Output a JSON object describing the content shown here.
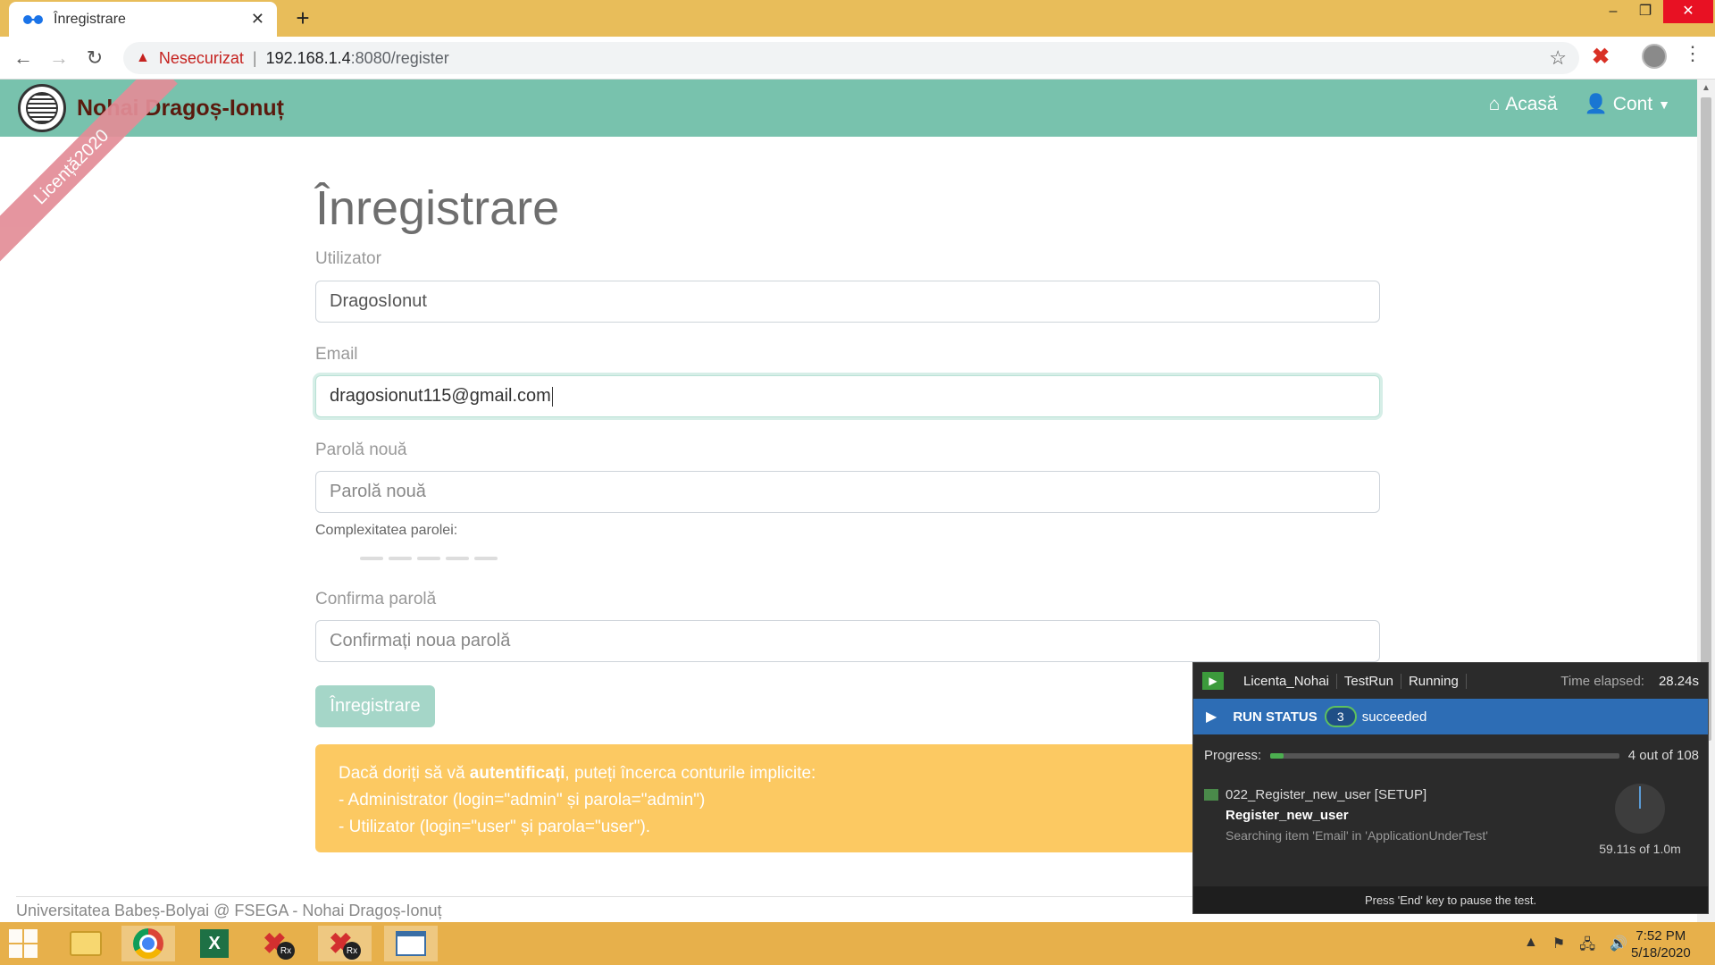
{
  "browser": {
    "tab_title": "Înregistrare",
    "new_tab": "+",
    "url_warning": "Nesecurizat",
    "url_host": "192.168.1.4",
    "url_path": ":8080/register",
    "window_minimize": "–",
    "window_restore": "❐",
    "window_close": "✕"
  },
  "navbar": {
    "brand": "Nohai Dragoș-Ionuț",
    "home": "Acasă",
    "account": "Cont"
  },
  "ribbon": "Licență2020",
  "form": {
    "title": "Înregistrare",
    "username_label": "Utilizator",
    "username_value": "DragosIonut",
    "email_label": "Email",
    "email_value": "dragosionut115@gmail.com",
    "password_label": "Parolă nouă",
    "password_placeholder": "Parolă nouă",
    "strength_label": "Complexitatea parolei:",
    "confirm_label": "Confirma parolă",
    "confirm_placeholder": "Confirmați noua parolă",
    "submit": "Înregistrare"
  },
  "alert": {
    "line1_pre": "Dacă doriți să vă",
    "line1_bold": "autentificați",
    "line1_post": ", puteți încerca conturile implicite:",
    "line2": "- Administrator (login=\"admin\" și parola=\"admin\")",
    "line3": "- Utilizator (login=\"user\" și parola=\"user\")."
  },
  "footer": "Universitatea Babeș-Bolyai @ FSEGA - Nohai Dragoș-Ionuț",
  "test_runner": {
    "project": "Licenta_Nohai",
    "run": "TestRun",
    "state": "Running",
    "elapsed_label": "Time elapsed:",
    "elapsed_value": "28.24s",
    "run_status": "RUN STATUS",
    "succeeded_count": "3",
    "succeeded_label": "succeeded",
    "progress_label": "Progress:",
    "progress_text": "4 out of 108",
    "progress_fraction": 0.037,
    "step_name": "022_Register_new_user [SETUP]",
    "module": "Register_new_user",
    "action": "Searching item 'Email' in 'ApplicationUnderTest'",
    "timeout": "59.11s of 1.0m",
    "footer_hint": "Press 'End' key to pause the test."
  },
  "taskbar": {
    "time": "7:52 PM",
    "date": "5/18/2020"
  },
  "colors": {
    "navbar": "#78c2ad",
    "brand": "#5a1a0e",
    "alert": "#fcc962",
    "submit": "#a5d6c8",
    "run_status": "#2d6db5",
    "taskbar": "#e7b04b"
  }
}
